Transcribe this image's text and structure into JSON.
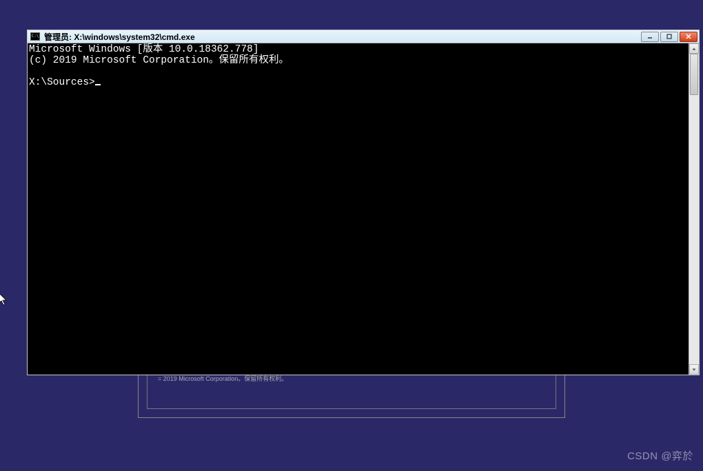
{
  "window": {
    "title": "管理员: X:\\windows\\system32\\cmd.exe",
    "icon_glyph": "C:\\"
  },
  "terminal": {
    "line1": "Microsoft Windows [版本 10.0.18362.778]",
    "line2": "(c) 2019 Microsoft Corporation。保留所有权利。",
    "prompt": "X:\\Sources>"
  },
  "background_dialog": {
    "footer_text": "= 2019 Microsoft Corporation。保留所有权利。"
  },
  "watermark": "CSDN @弈於"
}
